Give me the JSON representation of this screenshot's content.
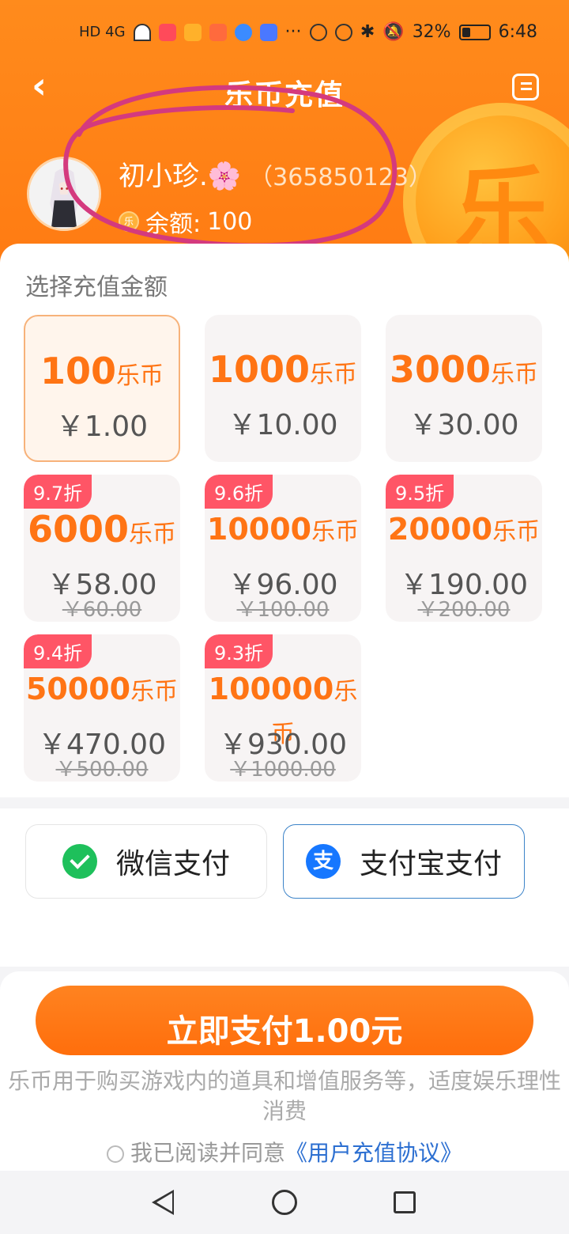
{
  "status_bar": {
    "network": "HD 4G",
    "battery": "32%",
    "time": "6:48",
    "more": "···"
  },
  "header": {
    "title": "乐币充值",
    "back_icon": "chevron-left-icon",
    "menu_icon": "document-list-icon",
    "coin_char": "乐"
  },
  "user": {
    "name": "初小珍.🌸",
    "id": "（365850123）",
    "balance_label": "余额:",
    "balance_value": "100",
    "coin_icon_char": "乐"
  },
  "recharge": {
    "section_label": "选择充值金额",
    "currency_unit": "乐币",
    "options": [
      {
        "amount": "100",
        "price": "￥1.00",
        "original": "",
        "discount": "",
        "selected": true
      },
      {
        "amount": "1000",
        "price": "￥10.00",
        "original": "",
        "discount": "",
        "selected": false
      },
      {
        "amount": "3000",
        "price": "￥30.00",
        "original": "",
        "discount": "",
        "selected": false
      },
      {
        "amount": "6000",
        "price": "￥58.00",
        "original": "￥60.00",
        "discount": "9.7折",
        "selected": false
      },
      {
        "amount": "10000",
        "price": "￥96.00",
        "original": "￥100.00",
        "discount": "9.6折",
        "selected": false
      },
      {
        "amount": "20000",
        "price": "￥190.00",
        "original": "￥200.00",
        "discount": "9.5折",
        "selected": false
      },
      {
        "amount": "50000",
        "price": "￥470.00",
        "original": "￥500.00",
        "discount": "9.4折",
        "selected": false
      },
      {
        "amount": "100000",
        "price": "￥930.00",
        "original": "￥1000.00",
        "discount": "9.3折",
        "selected": false
      }
    ]
  },
  "payment": {
    "wechat_label": "微信支付",
    "alipay_label": "支付宝支付",
    "alipay_icon_char": "支",
    "selected": "alipay"
  },
  "checkout": {
    "pay_button": "立即支付1.00元",
    "notice": "乐币用于购买游戏内的道具和增值服务等，适度娱乐理性消费",
    "agree_prefix": "我已阅读并同意",
    "agree_link": "《用户充值协议》"
  },
  "colors": {
    "brand_orange": "#ff7a12",
    "price_orange": "#ff7414",
    "discount_red": "#ff5566",
    "link_blue": "#2c6fd1",
    "annotation_magenta": "#d43a7e"
  }
}
